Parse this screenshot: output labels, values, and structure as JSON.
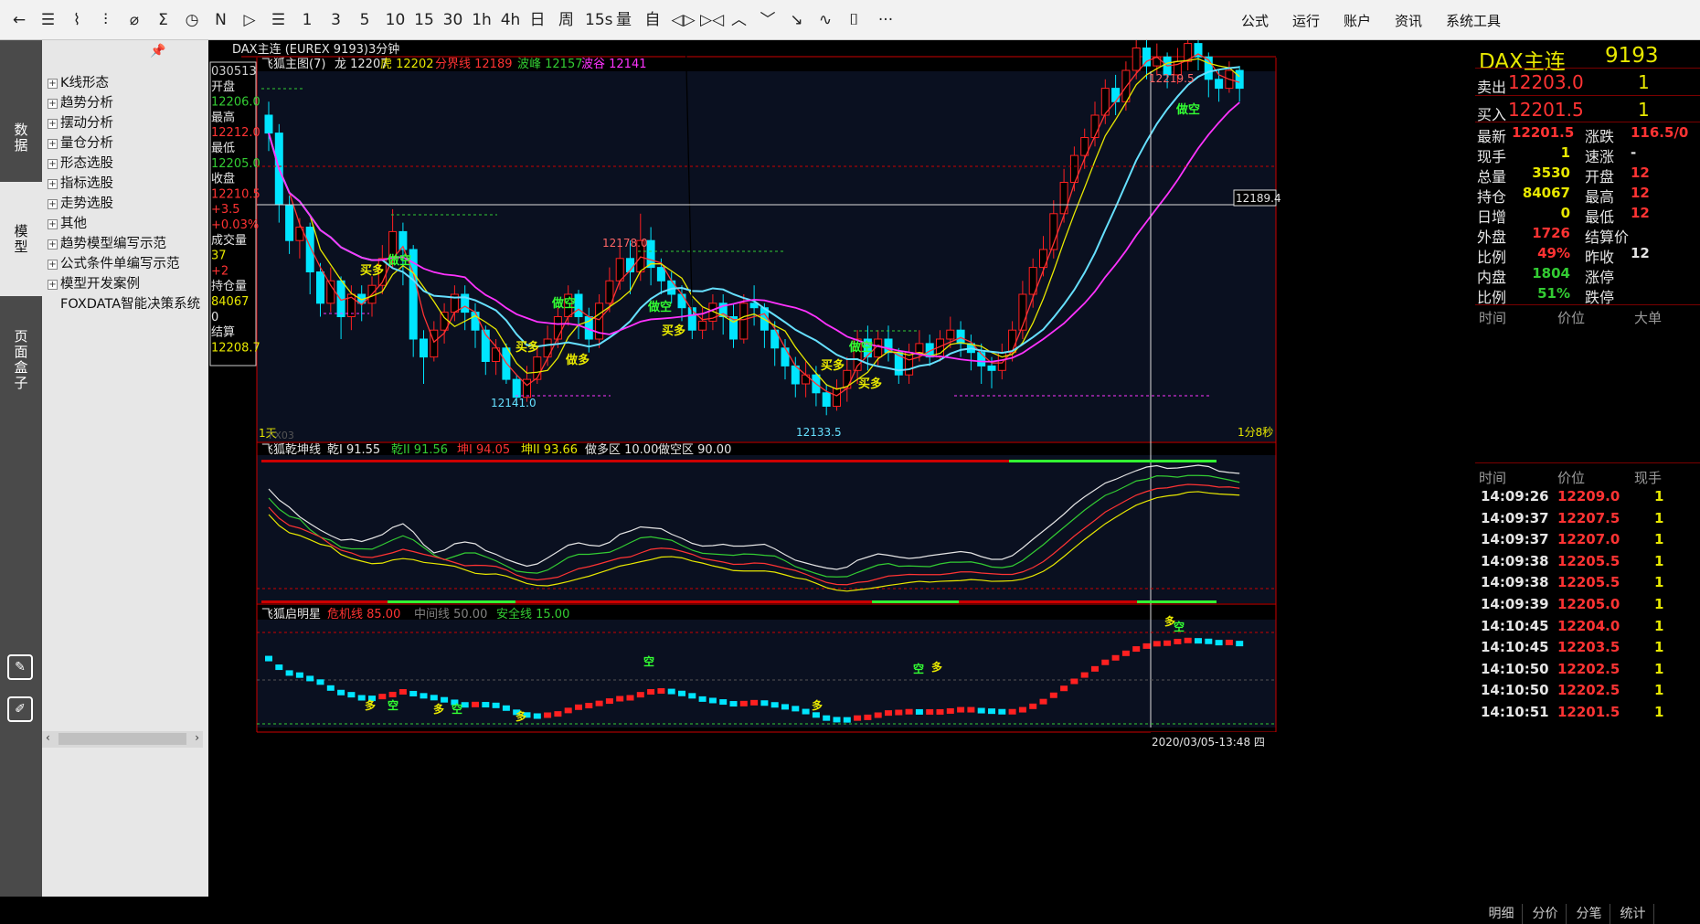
{
  "toolbar": {
    "items": [
      "←",
      "☰",
      "⌇",
      "⫶",
      "⌀",
      "Σ",
      "◷",
      "N",
      "▷",
      "☰",
      "1",
      "3",
      "5",
      "10",
      "15",
      "30",
      "1h",
      "4h",
      "日",
      "周",
      "15s",
      "量",
      "自",
      "◁▷",
      "▷◁",
      "︿",
      "﹀",
      "↘",
      "∿",
      "⌷",
      "···"
    ],
    "menu": [
      "公式",
      "运行",
      "账户",
      "资讯",
      "系统工具"
    ]
  },
  "sidebar": {
    "tabs": [
      "数据",
      "模型",
      "页面盒子"
    ],
    "tree": [
      {
        "label": "K线形态",
        "sign": "+"
      },
      {
        "label": "趋势分析",
        "sign": "+"
      },
      {
        "label": "摆动分析",
        "sign": "+"
      },
      {
        "label": "量仓分析",
        "sign": "+"
      },
      {
        "label": "形态选股",
        "sign": "+"
      },
      {
        "label": "指标选股",
        "sign": "+"
      },
      {
        "label": "走势选股",
        "sign": "+"
      },
      {
        "label": "其他",
        "sign": "+"
      },
      {
        "label": "趋势模型编写示范",
        "sign": "+"
      },
      {
        "label": "公式条件单编写示范",
        "sign": "+"
      },
      {
        "label": "模型开发案例",
        "sign": "+"
      },
      {
        "label": "FOXDATA智能决策系统",
        "sign": ""
      }
    ]
  },
  "chart": {
    "title": "DAX主连 (EUREX 9193)3分钟",
    "info_box": [
      {
        "text": "030513",
        "color": "#cccccc"
      },
      {
        "text": "开盘",
        "color": "#e5e5e5"
      },
      {
        "text": "12206.0",
        "color": "#33cc33"
      },
      {
        "text": "最高",
        "color": "#e5e5e5"
      },
      {
        "text": "12212.0",
        "color": "#ff3333"
      },
      {
        "text": "最低",
        "color": "#e5e5e5"
      },
      {
        "text": "12205.0",
        "color": "#33cc33"
      },
      {
        "text": "收盘",
        "color": "#e5e5e5"
      },
      {
        "text": "12210.5",
        "color": "#ff3333"
      },
      {
        "text": "+3.5",
        "color": "#ff3333"
      },
      {
        "text": "+0.03%",
        "color": "#ff3333"
      },
      {
        "text": "成交量",
        "color": "#e5e5e5"
      },
      {
        "text": "37",
        "color": "#e8e800"
      },
      {
        "text": "+2",
        "color": "#ff3333"
      },
      {
        "text": "持仓量",
        "color": "#e5e5e5"
      },
      {
        "text": "84067",
        "color": "#e8e800"
      },
      {
        "text": "0",
        "color": "#e5e5e5"
      },
      {
        "text": "结算",
        "color": "#e5e5e5"
      },
      {
        "text": "12208.7",
        "color": "#e8e800"
      }
    ],
    "main_legend": [
      {
        "text": "飞狐主图(7)",
        "color": "#e5e5e5"
      },
      {
        "text": "龙 12207",
        "color": "#e5e5e5"
      },
      {
        "text": "虎 12202",
        "color": "#e8e800"
      },
      {
        "text": "分界线 12189",
        "color": "#ff3333"
      },
      {
        "text": "波峰 12157",
        "color": "#33cc33"
      },
      {
        "text": "波谷 12141",
        "color": "#ff33ff"
      }
    ],
    "price_labels": [
      "12219.5",
      "12178.0",
      "12141.0",
      "12133.5"
    ],
    "crosshair_price": "12189.4",
    "countdown": "1分8秒",
    "period_label": "1天",
    "period_label_b": "FX03",
    "signals": [
      "买多",
      "做空",
      "做空",
      "买多",
      "做多",
      "做空",
      "买多",
      "买多",
      "做空",
      "买多",
      "做空"
    ],
    "osc_legend": [
      {
        "text": "飞狐乾坤线",
        "color": "#e5e5e5"
      },
      {
        "text": "乾I 91.55",
        "color": "#e5e5e5"
      },
      {
        "text": "乾II 91.56",
        "color": "#33cc33"
      },
      {
        "text": "坤I 94.05",
        "color": "#ff3333"
      },
      {
        "text": "坤II 93.66",
        "color": "#e8e800"
      },
      {
        "text": "做多区 10.00",
        "color": "#e5e5e5"
      },
      {
        "text": "做空区 90.00",
        "color": "#e5e5e5"
      }
    ],
    "star_legend": [
      {
        "text": "飞狐启明星",
        "color": "#e5e5e5"
      },
      {
        "text": "危机线 85.00",
        "color": "#ff3333"
      },
      {
        "text": "中间线 50.00",
        "color": "#808080"
      },
      {
        "text": "安全线 15.00",
        "color": "#33cc33"
      }
    ],
    "star_signals": [
      "多",
      "空",
      "多",
      "空",
      "多",
      "空",
      "多",
      "多",
      "空",
      "多",
      "空"
    ],
    "datetime": "2020/03/05-13:48 四"
  },
  "quote": {
    "name": "DAX主连",
    "code": "9193",
    "ask_label": "卖出",
    "ask_price": "12203.0",
    "ask_vol": "1",
    "bid_label": "买入",
    "bid_price": "12201.5",
    "bid_vol": "1",
    "rows": [
      {
        "l1": "最新",
        "v1": "12201.5",
        "c1": "#ff3333",
        "l2": "涨跌",
        "v2": "116.5/0",
        "c2": "#ff3333"
      },
      {
        "l1": "现手",
        "v1": "1",
        "c1": "#e8e800",
        "l2": "速涨",
        "v2": "-",
        "c2": "#e5e5e5"
      },
      {
        "l1": "总量",
        "v1": "3530",
        "c1": "#e8e800",
        "l2": "开盘",
        "v2": "12",
        "c2": "#ff3333"
      },
      {
        "l1": "持仓",
        "v1": "84067",
        "c1": "#e8e800",
        "l2": "最高",
        "v2": "12",
        "c2": "#ff3333"
      },
      {
        "l1": "日增",
        "v1": "0",
        "c1": "#e8e800",
        "l2": "最低",
        "v2": "12",
        "c2": "#ff3333"
      },
      {
        "l1": "外盘",
        "v1": "1726",
        "c1": "#ff3333",
        "l2": "结算价",
        "v2": "",
        "c2": "#e5e5e5"
      },
      {
        "l1": "比例",
        "v1": "49%",
        "c1": "#ff3333",
        "l2": "昨收",
        "v2": "12",
        "c2": "#e5e5e5"
      },
      {
        "l1": "内盘",
        "v1": "1804",
        "c1": "#33cc33",
        "l2": "涨停",
        "v2": "",
        "c2": "#e5e5e5"
      },
      {
        "l1": "比例",
        "v1": "51%",
        "c1": "#33cc33",
        "l2": "跌停",
        "v2": "",
        "c2": "#e5e5e5"
      }
    ],
    "section1_headers": [
      "时间",
      "价位",
      "大单"
    ],
    "section2_headers": [
      "时间",
      "价位",
      "现手"
    ],
    "ticks": [
      {
        "t": "14:09:26",
        "p": "12209.0",
        "v": "1"
      },
      {
        "t": "14:09:37",
        "p": "12207.5",
        "v": "1"
      },
      {
        "t": "14:09:37",
        "p": "12207.0",
        "v": "1"
      },
      {
        "t": "14:09:38",
        "p": "12205.5",
        "v": "1"
      },
      {
        "t": "14:09:38",
        "p": "12205.5",
        "v": "1"
      },
      {
        "t": "14:09:39",
        "p": "12205.0",
        "v": "1"
      },
      {
        "t": "14:10:45",
        "p": "12204.0",
        "v": "1"
      },
      {
        "t": "14:10:45",
        "p": "12203.5",
        "v": "1"
      },
      {
        "t": "14:10:50",
        "p": "12202.5",
        "v": "1"
      },
      {
        "t": "14:10:50",
        "p": "12202.5",
        "v": "1"
      },
      {
        "t": "14:10:51",
        "p": "12201.5",
        "v": "1"
      }
    ],
    "bottom_tabs": [
      "明细",
      "分价",
      "分笔",
      "统计"
    ]
  },
  "colors": {
    "up": "#ff2020",
    "down": "#00e5ff",
    "bg": "#000000",
    "panel_bg": "#0a1020"
  }
}
